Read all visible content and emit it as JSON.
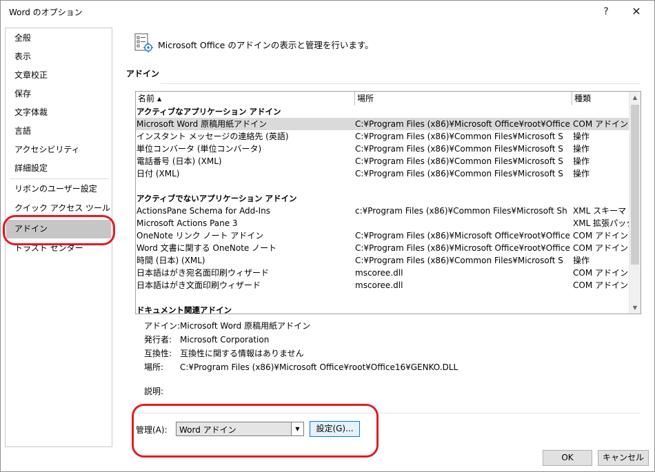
{
  "window": {
    "title": "Word のオプション",
    "help_glyph": "?",
    "close_glyph": "✕"
  },
  "nav": {
    "items": [
      {
        "label": "全般"
      },
      {
        "label": "表示"
      },
      {
        "label": "文章校正"
      },
      {
        "label": "保存"
      },
      {
        "label": "文字体裁"
      },
      {
        "label": "言語"
      },
      {
        "label": "アクセシビリティ"
      },
      {
        "label": "詳細設定"
      },
      {
        "label": "リボンのユーザー設定"
      },
      {
        "label": "クイック アクセス ツール バー"
      },
      {
        "label": "アドイン",
        "selected": true
      },
      {
        "label": "トラスト センター"
      }
    ]
  },
  "main": {
    "heading": "Microsoft Office のアドインの表示と管理を行います。",
    "section_title": "アドイン",
    "columns": {
      "name": "名前",
      "location": "場所",
      "type": "種類"
    },
    "groups": [
      {
        "title": "アクティブなアプリケーション アドイン",
        "rows": [
          {
            "name": "Microsoft Word 原稿用紙アドイン",
            "location": "C:¥Program Files (x86)¥Microsoft Office¥root¥Office",
            "type": "COM アドイン",
            "selected": true
          },
          {
            "name": "インスタント メッセージの連絡先 (英語)",
            "location": "C:¥Program Files (x86)¥Common Files¥Microsoft S",
            "type": "操作"
          },
          {
            "name": "単位コンバータ (単位コンバータ)",
            "location": "C:¥Program Files (x86)¥Common Files¥Microsoft S",
            "type": "操作"
          },
          {
            "name": "電話番号 (日本) (XML)",
            "location": "C:¥Program Files (x86)¥Common Files¥Microsoft S",
            "type": "操作"
          },
          {
            "name": "日付 (XML)",
            "location": "C:¥Program Files (x86)¥Common Files¥Microsoft S",
            "type": "操作"
          }
        ]
      },
      {
        "title": "アクティブでないアプリケーション アドイン",
        "rows": [
          {
            "name": "ActionsPane Schema for Add-Ins",
            "location": "c:¥Program Files (x86)¥Common Files¥Microsoft Sh",
            "type": "XML スキーマ"
          },
          {
            "name": "Microsoft Actions Pane 3",
            "location": "",
            "type": "XML 拡張パック"
          },
          {
            "name": "OneNote リンク ノート アドイン",
            "location": "C:¥Program Files (x86)¥Microsoft Office¥root¥Office",
            "type": "COM アドイン"
          },
          {
            "name": "Word 文書に関する OneNote ノート",
            "location": "C:¥Program Files (x86)¥Microsoft Office¥root¥Office",
            "type": "COM アドイン"
          },
          {
            "name": "時間 (日本) (XML)",
            "location": "C:¥Program Files (x86)¥Common Files¥Microsoft S",
            "type": "操作"
          },
          {
            "name": "日本語はがき宛名面印刷ウィザード",
            "location": "mscoree.dll",
            "type": "COM アドイン"
          },
          {
            "name": "日本語はがき文面印刷ウィザード",
            "location": "mscoree.dll",
            "type": "COM アドイン"
          }
        ]
      },
      {
        "title": "ドキュメント関連アドイン",
        "rows": []
      }
    ],
    "details": [
      {
        "label": "アドイン:",
        "value": "Microsoft Word 原稿用紙アドイン"
      },
      {
        "label": "発行者:",
        "value": "Microsoft Corporation"
      },
      {
        "label": "互換性:",
        "value": "互換性に関する情報はありません"
      },
      {
        "label": "場所:",
        "value": "C:¥Program Files (x86)¥Microsoft Office¥root¥Office16¥GENKO.DLL"
      },
      {
        "label": "説明:",
        "value": ""
      }
    ],
    "manage": {
      "label": "管理(A):",
      "selected": "Word アドイン",
      "settings_button": "設定(G)..."
    }
  },
  "footer": {
    "ok": "OK",
    "cancel": "キャンセル"
  },
  "colors": {
    "annotation": "#e01b24",
    "selection": "#c6c6c6"
  }
}
